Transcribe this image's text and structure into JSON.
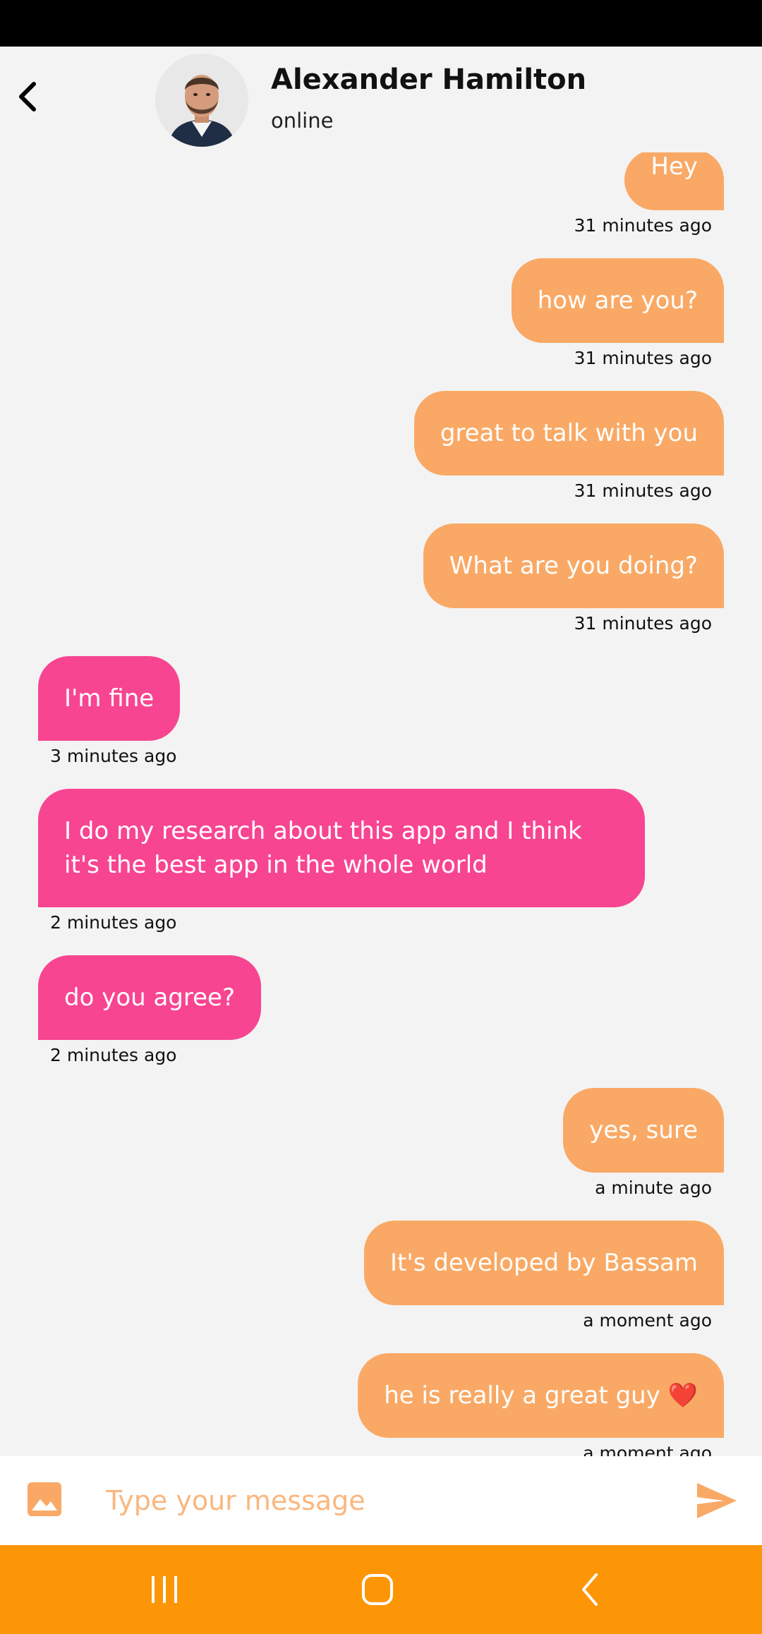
{
  "header": {
    "contact_name": "Alexander Hamilton",
    "status": "online",
    "back_icon": "chevron-left-icon"
  },
  "messages": [
    {
      "direction": "sent",
      "text": "Hey",
      "time": "31 minutes ago"
    },
    {
      "direction": "sent",
      "text": "how are you?",
      "time": "31 minutes ago"
    },
    {
      "direction": "sent",
      "text": "great to talk with you",
      "time": "31 minutes ago"
    },
    {
      "direction": "sent",
      "text": "What are you doing?",
      "time": "31 minutes ago"
    },
    {
      "direction": "received",
      "text": "I'm fine",
      "time": "3 minutes ago"
    },
    {
      "direction": "received",
      "text": "I do my research about this app and I think it's the best app in the whole world",
      "time": "2 minutes ago"
    },
    {
      "direction": "received",
      "text": "do you agree?",
      "time": "2 minutes ago"
    },
    {
      "direction": "sent",
      "text": "yes, sure",
      "time": "a minute ago"
    },
    {
      "direction": "sent",
      "text": "It's developed by Bassam",
      "time": "a moment ago"
    },
    {
      "direction": "sent",
      "text": "he is really a great guy ❤️",
      "time": "a moment ago"
    }
  ],
  "composer": {
    "placeholder": "Type your message",
    "image_icon": "image-icon",
    "send_icon": "send-icon"
  },
  "colors": {
    "sent_bubble": "#f9a965",
    "received_bubble": "#f84591",
    "nav_bar": "#fd9607",
    "background": "#f3f3f3"
  },
  "nav_bar": {
    "icons": [
      "recent-apps-icon",
      "home-icon",
      "back-icon"
    ]
  }
}
